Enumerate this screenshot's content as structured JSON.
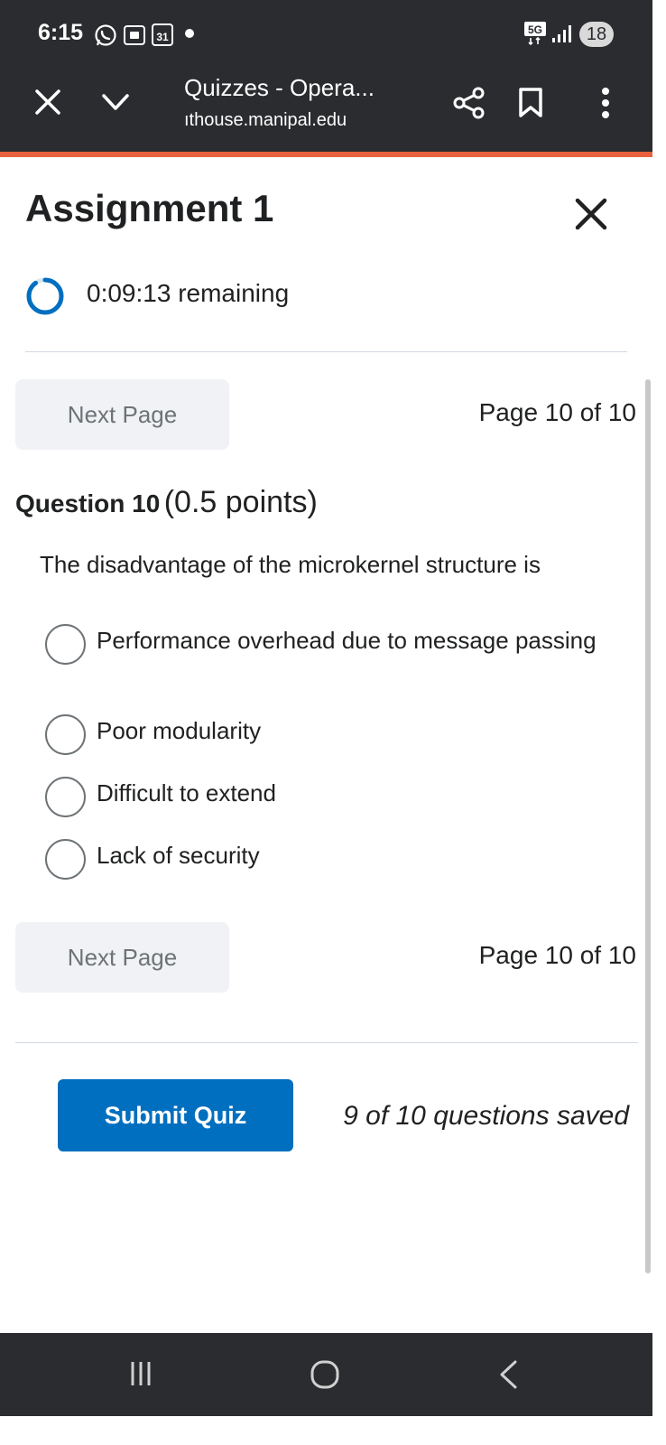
{
  "status_bar": {
    "time": "6:15",
    "icons": [
      "whatsapp-icon",
      "screenshot-icon",
      "calendar-icon",
      "notification-dot"
    ],
    "calendar_day": "31",
    "network": "5G",
    "battery": "18"
  },
  "browser": {
    "page_title": "Quizzes - Opera...",
    "url": "ıthouse.manipal.edu",
    "actions": [
      "close-icon",
      "chevron-down-icon",
      "share-icon",
      "bookmark-icon",
      "more-vertical-icon"
    ]
  },
  "quiz": {
    "title": "Assignment 1",
    "timer_text": "0:09:13 remaining",
    "timer_progress": 0.9,
    "next_page_label": "Next Page",
    "page_indicator": "Page 10 of 10",
    "question": {
      "label": "Question 10",
      "points": "(0.5 points)",
      "text": "The disadvantage of the microkernel structure is",
      "options": [
        "Performance overhead due to message passing",
        "Poor modularity",
        "Difficult to extend",
        "Lack of security"
      ]
    },
    "submit_label": "Submit Quiz",
    "saved_status": "9 of 10 questions saved"
  },
  "colors": {
    "topbar_bg": "#2b2c2f",
    "accent": "#e8613f",
    "primary": "#006fbf",
    "button_bg": "#f1f2f5"
  },
  "navigation": {
    "buttons": [
      "recent-apps-icon",
      "home-icon",
      "back-icon"
    ]
  }
}
